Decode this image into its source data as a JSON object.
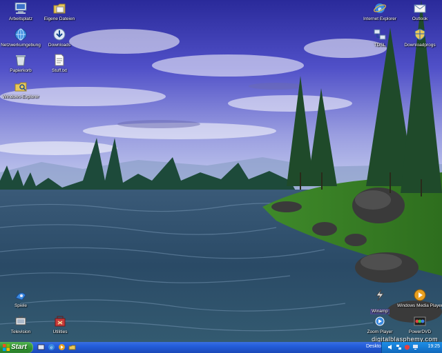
{
  "desktop_icons_left": [
    {
      "name": "arbeitsplatz",
      "label": "Arbeitsplatz",
      "icon": "computer-icon"
    },
    {
      "name": "eigene-dateien",
      "label": "Eigene Dateien",
      "icon": "documents-folder-icon"
    },
    {
      "name": "netzwerkumgebung",
      "label": "Netzwerkumgebung",
      "icon": "network-globe-icon"
    },
    {
      "name": "downloads",
      "label": "Downloads",
      "icon": "downloads-icon"
    },
    {
      "name": "papierkorb",
      "label": "Papierkorb",
      "icon": "recycle-bin-icon"
    },
    {
      "name": "stuff-txt",
      "label": "Stuff.txt",
      "icon": "text-file-icon"
    },
    {
      "name": "windows-explorer",
      "label": "Windows-Explorer",
      "icon": "explorer-icon"
    }
  ],
  "desktop_icons_right": [
    {
      "name": "internet-explorer",
      "label": "Internet Explorer",
      "icon": "ie-icon"
    },
    {
      "name": "outlook",
      "label": "Outlook",
      "icon": "mail-icon"
    },
    {
      "name": "tdsl",
      "label": "TDSL",
      "icon": "network-icon"
    },
    {
      "name": "downloadprogs",
      "label": "Downloadprogs",
      "icon": "shield-icon"
    }
  ],
  "desktop_icons_bottom": [
    {
      "name": "spiele",
      "label": "Spiele",
      "icon": "games-icon"
    },
    {
      "name": "television",
      "label": "Television",
      "icon": "television-icon"
    },
    {
      "name": "utilities",
      "label": "Utilities",
      "icon": "toolbox-icon"
    },
    {
      "name": "winamp",
      "label": "Winamp",
      "icon": "winamp-icon"
    },
    {
      "name": "windows-media-player",
      "label": "Windows Media Player",
      "icon": "media-player-icon"
    },
    {
      "name": "zoom-player",
      "label": "Zoom Player",
      "icon": "zoom-player-icon"
    },
    {
      "name": "powerdvd",
      "label": "PowerDVD",
      "icon": "dvd-icon"
    }
  ],
  "watermark": "digitalblasphemy.com",
  "taskbar": {
    "start_label": "Start",
    "toolbar_label": "Desktop",
    "clock": "19:25",
    "quicklaunch": [
      "show-desktop-icon",
      "ie-icon",
      "media-player-icon",
      "explorer-icon"
    ],
    "tray": [
      "volume-icon",
      "network-icon",
      "security-icon",
      "monitor-icon"
    ]
  },
  "colors": {
    "taskbar": "#245edb",
    "start": "#2f8f2f",
    "tray": "#1578d0"
  }
}
